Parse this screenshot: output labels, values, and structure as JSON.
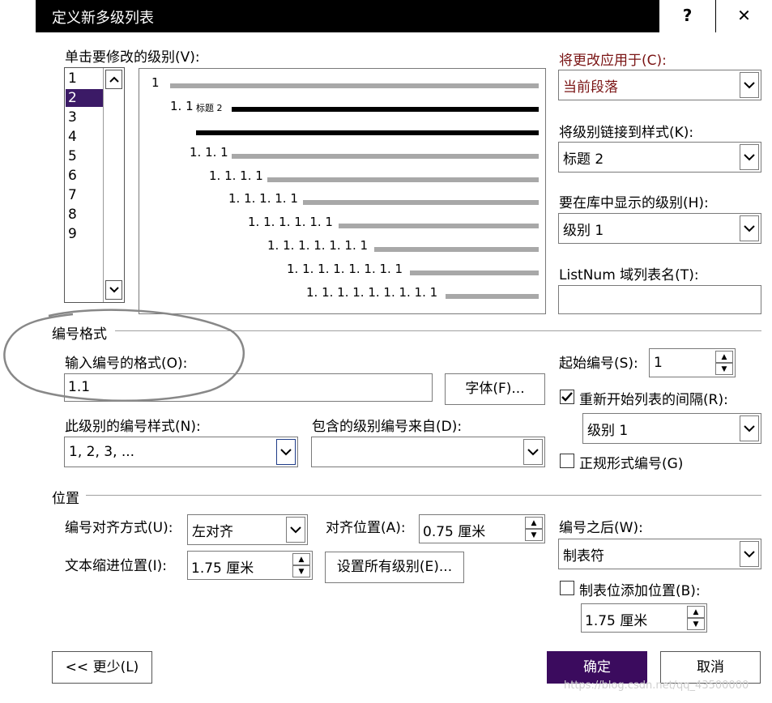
{
  "window": {
    "title": "定义新多级列表",
    "help_label": "?",
    "close_label": "✕"
  },
  "level_select": {
    "label": "单击要修改的级别(V):",
    "items": [
      "1",
      "2",
      "3",
      "4",
      "5",
      "6",
      "7",
      "8",
      "9"
    ],
    "selected": "2"
  },
  "preview": {
    "rows": [
      {
        "text": "1"
      },
      {
        "text": "1. 1",
        "style_tag": "标题 2"
      },
      {
        "text": ""
      },
      {
        "text": "1. 1. 1"
      },
      {
        "text": "1. 1. 1. 1"
      },
      {
        "text": "1. 1. 1. 1. 1"
      },
      {
        "text": "1. 1. 1. 1. 1. 1"
      },
      {
        "text": "1. 1. 1. 1. 1. 1. 1"
      },
      {
        "text": "1. 1. 1. 1. 1. 1. 1. 1"
      },
      {
        "text": "1. 1. 1. 1. 1. 1. 1. 1. 1"
      }
    ]
  },
  "right_panel": {
    "apply_to_label": "将更改应用于(C):",
    "apply_to_value": "当前段落",
    "link_style_label": "将级别链接到样式(K):",
    "link_style_value": "标题 2",
    "gallery_level_label": "要在库中显示的级别(H):",
    "gallery_level_value": "级别 1",
    "listnum_label": "ListNum 域列表名(T):",
    "listnum_value": ""
  },
  "number_format": {
    "section_label": "编号格式",
    "format_label": "输入编号的格式(O):",
    "format_value": "1.1",
    "font_button": "字体(F)...",
    "start_at_label": "起始编号(S):",
    "start_at_value": "1",
    "restart_label": "重新开始列表的间隔(R):",
    "restart_value": "级别 1",
    "style_label": "此级别的编号样式(N):",
    "style_value": "1, 2, 3, ...",
    "include_label": "包含的级别编号来自(D):",
    "include_value": "",
    "legal_label": "正规形式编号(G)"
  },
  "position": {
    "section_label": "位置",
    "alignment_label": "编号对齐方式(U):",
    "alignment_value": "左对齐",
    "aligned_at_label": "对齐位置(A):",
    "aligned_at_value": "0.75 厘米",
    "indent_label": "文本缩进位置(I):",
    "indent_value": "1.75 厘米",
    "set_all_button": "设置所有级别(E)...",
    "follow_label": "编号之后(W):",
    "follow_value": "制表符",
    "tab_stop_label": "制表位添加位置(B):",
    "tab_stop_value": "1.75 厘米"
  },
  "footer": {
    "less_button": "<< 更少(L)",
    "ok_button": "确定",
    "cancel_button": "取消"
  },
  "watermark": "https://blog.csdn.net/qq_43500000",
  "colors": {
    "accent": "#3b0b5e",
    "selection": "#3b1a66"
  }
}
